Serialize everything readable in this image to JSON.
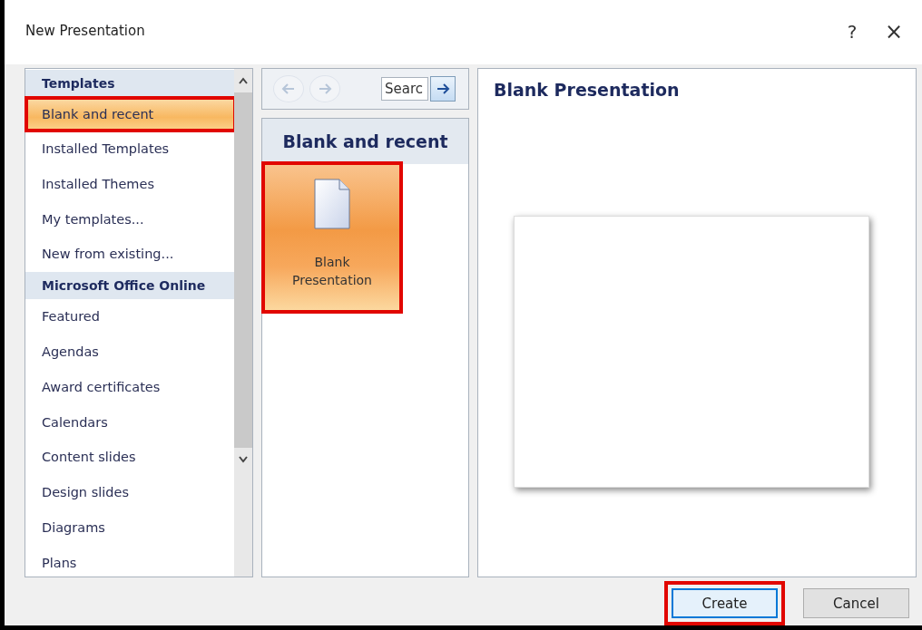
{
  "window": {
    "title": "New Presentation",
    "help": "?",
    "close": "×"
  },
  "sidebar": {
    "items": [
      {
        "kind": "header",
        "label": "Templates"
      },
      {
        "kind": "item",
        "label": "Blank and recent",
        "selected": true,
        "highlighted": true
      },
      {
        "kind": "item",
        "label": "Installed Templates",
        "selected": false,
        "highlighted": false
      },
      {
        "kind": "item",
        "label": "Installed Themes",
        "selected": false,
        "highlighted": false
      },
      {
        "kind": "item",
        "label": "My templates...",
        "selected": false,
        "highlighted": false
      },
      {
        "kind": "item",
        "label": "New from existing...",
        "selected": false,
        "highlighted": false
      },
      {
        "kind": "header",
        "label": "Microsoft Office Online"
      },
      {
        "kind": "item",
        "label": "Featured",
        "selected": false,
        "highlighted": false
      },
      {
        "kind": "item",
        "label": "Agendas",
        "selected": false,
        "highlighted": false
      },
      {
        "kind": "item",
        "label": "Award certificates",
        "selected": false,
        "highlighted": false
      },
      {
        "kind": "item",
        "label": "Calendars",
        "selected": false,
        "highlighted": false
      },
      {
        "kind": "item",
        "label": "Content slides",
        "selected": false,
        "highlighted": false
      },
      {
        "kind": "item",
        "label": "Design slides",
        "selected": false,
        "highlighted": false
      },
      {
        "kind": "item",
        "label": "Diagrams",
        "selected": false,
        "highlighted": false
      },
      {
        "kind": "item",
        "label": "Plans",
        "selected": false,
        "highlighted": false
      }
    ]
  },
  "browser": {
    "back_disabled": true,
    "forward_disabled": true,
    "search": {
      "value": "Searc"
    },
    "heading": "Blank and recent",
    "tiles": [
      {
        "label": "Blank Presentation",
        "selected": true,
        "highlighted": true
      }
    ]
  },
  "preview": {
    "title": "Blank Presentation"
  },
  "buttons": [
    {
      "label": "Create",
      "default": true,
      "highlighted": true
    },
    {
      "label": "Cancel",
      "default": false,
      "highlighted": false
    }
  ]
}
